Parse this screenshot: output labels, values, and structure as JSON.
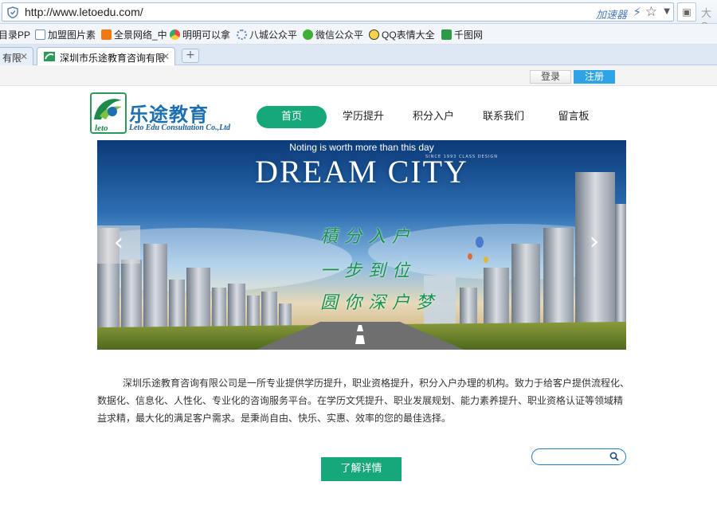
{
  "browser": {
    "url": "http://www.letoedu.com/",
    "accelerator": "加速器",
    "ext_text": "大S"
  },
  "bookmarks": [
    {
      "label": "目录PP",
      "icon": "bookmark-icon"
    },
    {
      "label": "加盟图片素",
      "icon": "page-icon"
    },
    {
      "label": "全景网络_中",
      "icon": "panorama-icon"
    },
    {
      "label": "明明可以拿",
      "icon": "chrome-icon"
    },
    {
      "label": "八城公众平",
      "icon": "gear-icon"
    },
    {
      "label": "微信公众平",
      "icon": "wechat-icon"
    },
    {
      "label": "QQ表情大全",
      "icon": "qq-icon"
    },
    {
      "label": "千图网",
      "icon": "qiantu-icon"
    }
  ],
  "tabs": {
    "inactive_label": "有限",
    "active_label": "深圳市乐途教育咨询有限",
    "new_tab": "+"
  },
  "topbar": {
    "login": "登录",
    "register": "注册"
  },
  "logo": {
    "cn": "乐途教育",
    "en": "Leto Edu Consultation Co.,Ltd",
    "mark": "leto"
  },
  "nav": [
    "首页",
    "学历提升",
    "积分入户",
    "联系我们",
    "留言板"
  ],
  "banner": {
    "tagline": "Noting is worth more than this day",
    "title": "DREAM CITY",
    "since": "SINCE 1993 CLASS DESIGN",
    "slogans": [
      "積分入户",
      "一步到位",
      "圆你深户梦"
    ]
  },
  "intro": "深圳乐途教育咨询有限公司是一所专业提供学历提升，职业资格提升，积分入户办理的机构。致力于给客户提供流程化、数据化、信息化、人性化、专业化的咨询服务平台。在学历文凭提升、职业发展规划、能力素养提升、职业资格认证等领域精益求精，最大化的满足客户需求。是秉尚自由、快乐、实惠、效率的您的最佳选择。",
  "more_button": "了解详情",
  "colors": {
    "brand_green": "#16a87b",
    "brand_blue": "#1c6fb0",
    "register_blue": "#2ea3e6"
  }
}
